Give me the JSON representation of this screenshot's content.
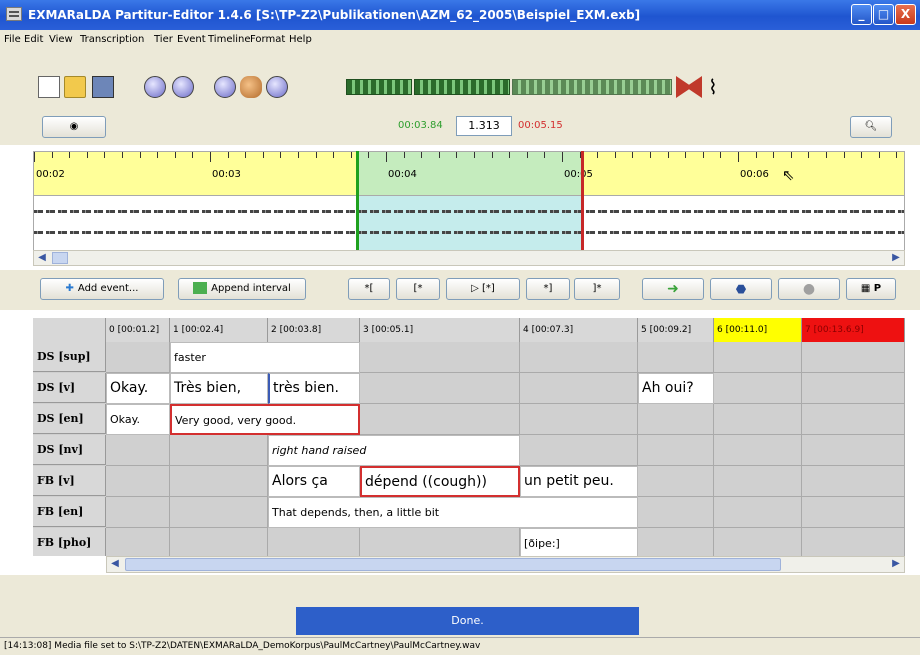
{
  "window": {
    "title": "EXMARaLDA Partitur-Editor 1.4.6 [S:\\TP-Z2\\Publikationen\\AZM_62_2005\\Beispiel_EXM.exb]",
    "minimize": "_",
    "maximize": "□",
    "close": "X"
  },
  "menu": [
    "File",
    "Edit",
    "View",
    "Transcription",
    "Tier",
    "Event",
    "Timeline",
    "Format",
    "Help"
  ],
  "toolbar": {
    "icons": [
      "new-document-icon",
      "open-folder-icon",
      "save-icon",
      "speaker-icon",
      "globe-icon",
      "record-icon",
      "people-icon",
      "link-icon",
      "tier-grid-icon",
      "red-bow-icon",
      "squiggle-icon"
    ]
  },
  "media": {
    "start_time": "00:03.84",
    "duration": "1.313",
    "end_time": "00:05.15",
    "start_color": "#2e9e2e",
    "end_color": "#d32f2f"
  },
  "timeline": {
    "labels": [
      "00:02",
      "00:03",
      "00:04",
      "00:05",
      "00:06"
    ]
  },
  "events_bar": {
    "add_event": "Add event...",
    "append_interval": "Append interval",
    "btn_a": "*[",
    "btn_b": "[*",
    "btn_play": "▷ [*]",
    "btn_c": "*]",
    "btn_d": "]*",
    "panel_p": "P"
  },
  "partitur": {
    "columns": [
      "0 [00:01.2]",
      "1 [00:02.4]",
      "2 [00:03.8]",
      "3 [00:05.1]",
      "4 [00:07.3]",
      "5 [00:09.2]",
      "6 [00:11.0]",
      "7 [00:13.6.9]"
    ],
    "rows": [
      "DS [sup]",
      "DS [v]",
      "DS [en]",
      "DS [nv]",
      "FB [v]",
      "FB [en]",
      "FB [pho]"
    ],
    "events": {
      "ds_sup_1": "faster",
      "ds_v_0": "Okay.",
      "ds_v_1": "Très bien,",
      "ds_v_2": "très bien.",
      "ds_v_5": "Ah oui?",
      "ds_en_0": "Okay.",
      "ds_en_1": "Very good, very good.",
      "ds_nv_2": "right hand raised",
      "fb_v_2": "Alors ça",
      "fb_v_3": "dépend ((cough))",
      "fb_v_4": "un petit peu.",
      "fb_en_2": "That depends, then, a little bit",
      "fb_pho_4": "[ðipe:]"
    }
  },
  "done_button": "Done.",
  "status_bar": "[14:13:08] Media file set to S:\\TP-Z2\\DATEN\\EXMARaLDA_DemoKorpus\\PaulMcCartney\\PaulMcCartney.wav"
}
